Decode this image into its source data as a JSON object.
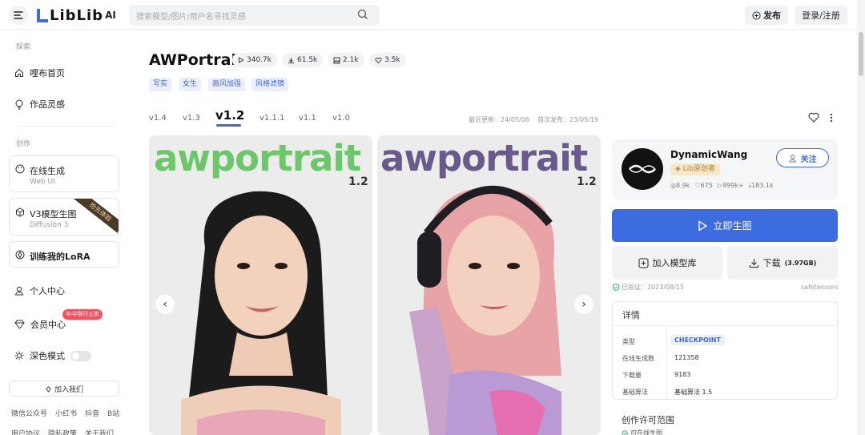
{
  "header": {
    "logo_text": "LibLib",
    "logo_ai": "AI",
    "search_placeholder": "搜索模型/图片/用户名寻找灵感",
    "publish_label": "发布",
    "login_label": "登录/注册"
  },
  "sidebar": {
    "explore_label": "探索",
    "items": [
      {
        "label": "哩布首页"
      },
      {
        "label": "作品灵感"
      }
    ],
    "create_label": "创作",
    "online_gen": {
      "title": "在线生成",
      "subtitle": "Web UI"
    },
    "v3_gen": {
      "title": "V3模型生图",
      "subtitle": "Diffusion 3",
      "ribbon": "抢先体验"
    },
    "lora_train": {
      "title": "训练我的LoRA"
    },
    "personal": "个人中心",
    "vip": "会员中心",
    "vip_badge": "年中限时五折",
    "dark_mode": "深色模式",
    "join": "加入我们",
    "footer_links_1": [
      "微信公众号",
      "小红书",
      "抖音",
      "B站"
    ],
    "footer_links_2": [
      "用户协议",
      "隐私政策",
      "关于我们"
    ]
  },
  "model": {
    "title": "AWPortrait",
    "stats": {
      "runs": "340.7k",
      "downloads": "61.5k",
      "images": "2.1k",
      "likes": "3.5k"
    },
    "tags": [
      "写实",
      "女生",
      "画风加强",
      "风格滤镜"
    ],
    "versions": [
      "v1.4",
      "v1.3",
      "v1.2",
      "v1.1.1",
      "v1.1",
      "v1.0"
    ],
    "active_version": "v1.2",
    "updated": "最近更新：24/05/06",
    "first_published": "首次发布：23/05/19",
    "images": [
      {
        "brand": "awportrait",
        "version": "1.2"
      },
      {
        "brand": "awportrait",
        "version": "1.2"
      }
    ]
  },
  "author": {
    "name": "DynamicWang",
    "badge": "Lib原创者",
    "stats": [
      "8.9k",
      "675",
      "999k+",
      "183.1k"
    ],
    "follow_label": "关注"
  },
  "actions": {
    "generate_label": "立即生图",
    "add_library_label": "加入模型库",
    "download_label": "下载",
    "download_size": "(3.97GB)",
    "verified": "已验证：2023/08/15",
    "format": "safetensors"
  },
  "details": {
    "title": "详情",
    "rows": [
      {
        "key": "类型",
        "value": "CHECKPOINT"
      },
      {
        "key": "在线生成数",
        "value": "121358"
      },
      {
        "key": "下载量",
        "value": "9183"
      },
      {
        "key": "基础算法",
        "value": "基础算法 1.5"
      }
    ]
  },
  "license": {
    "title": "创作许可范围",
    "first": "可在线生图"
  },
  "colors": {
    "accent": "#3d6ce0",
    "tag_bg": "#eaf0ff",
    "brand_green": "#6cc76a",
    "brand_purple": "#6a5a8c"
  }
}
